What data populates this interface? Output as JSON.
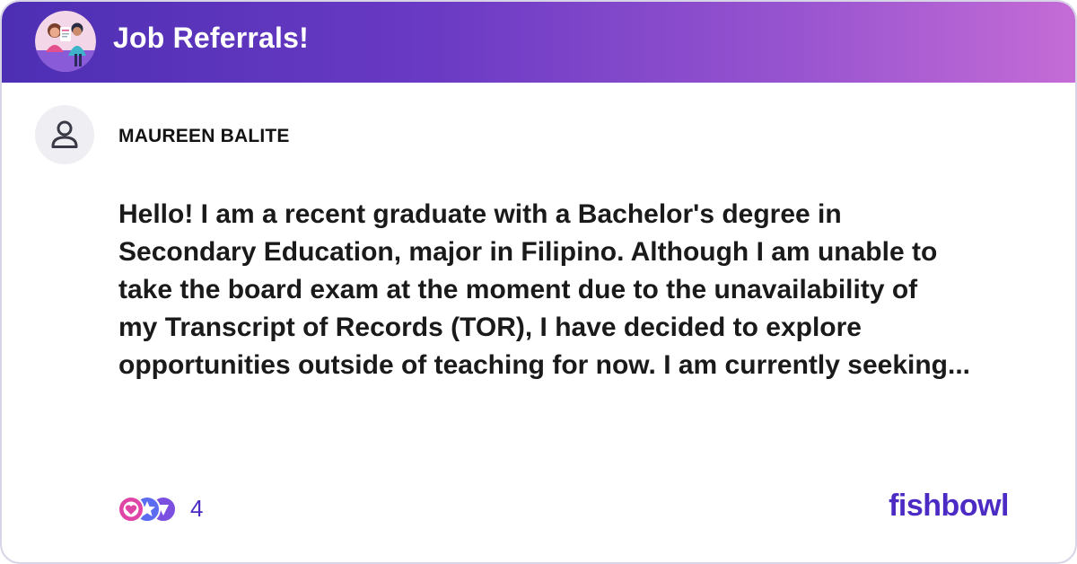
{
  "header": {
    "title": "Job Referrals!",
    "bowl_icon": "bowl-illustration-icon",
    "gradient_start": "#4d2fb4",
    "gradient_end": "#c56cd6"
  },
  "post": {
    "author": "MAUREEN BALITE",
    "avatar_icon": "user-icon",
    "text": "Hello! I am a recent graduate with a Bachelor's degree in\nSecondary Education, major in Filipino. Although I am unable to\ntake the board exam at the moment due to the unavailability of\nmy Transcript of Records (TOR), I have decided to explore\nopportunities outside of teaching for now. I am currently seeking..."
  },
  "footer": {
    "reaction_icons": [
      "heart-reaction-icon",
      "star-reaction-icon",
      "purple-reaction-icon"
    ],
    "reaction_count": "4",
    "brand": "fishbowl",
    "brand_color": "#4b2bc4"
  }
}
